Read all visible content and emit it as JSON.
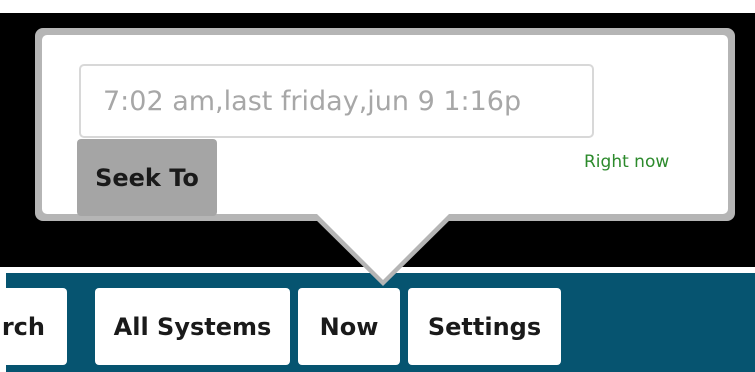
{
  "seek_popup": {
    "input_placeholder": "7:02 am,last friday,jun 9 1:16p",
    "seek_button_label": "Seek To",
    "right_now_link": "Right now"
  },
  "nav": {
    "items": [
      {
        "label": "rch"
      },
      {
        "label": "All Systems"
      },
      {
        "label": "Now"
      },
      {
        "label": "Settings"
      }
    ]
  },
  "colors": {
    "nav_background": "#065470",
    "header_background": "#000000",
    "popup_border": "#b5b5b5",
    "seek_button": "#a5a5a5",
    "right_now_link": "#2c8a2c"
  }
}
